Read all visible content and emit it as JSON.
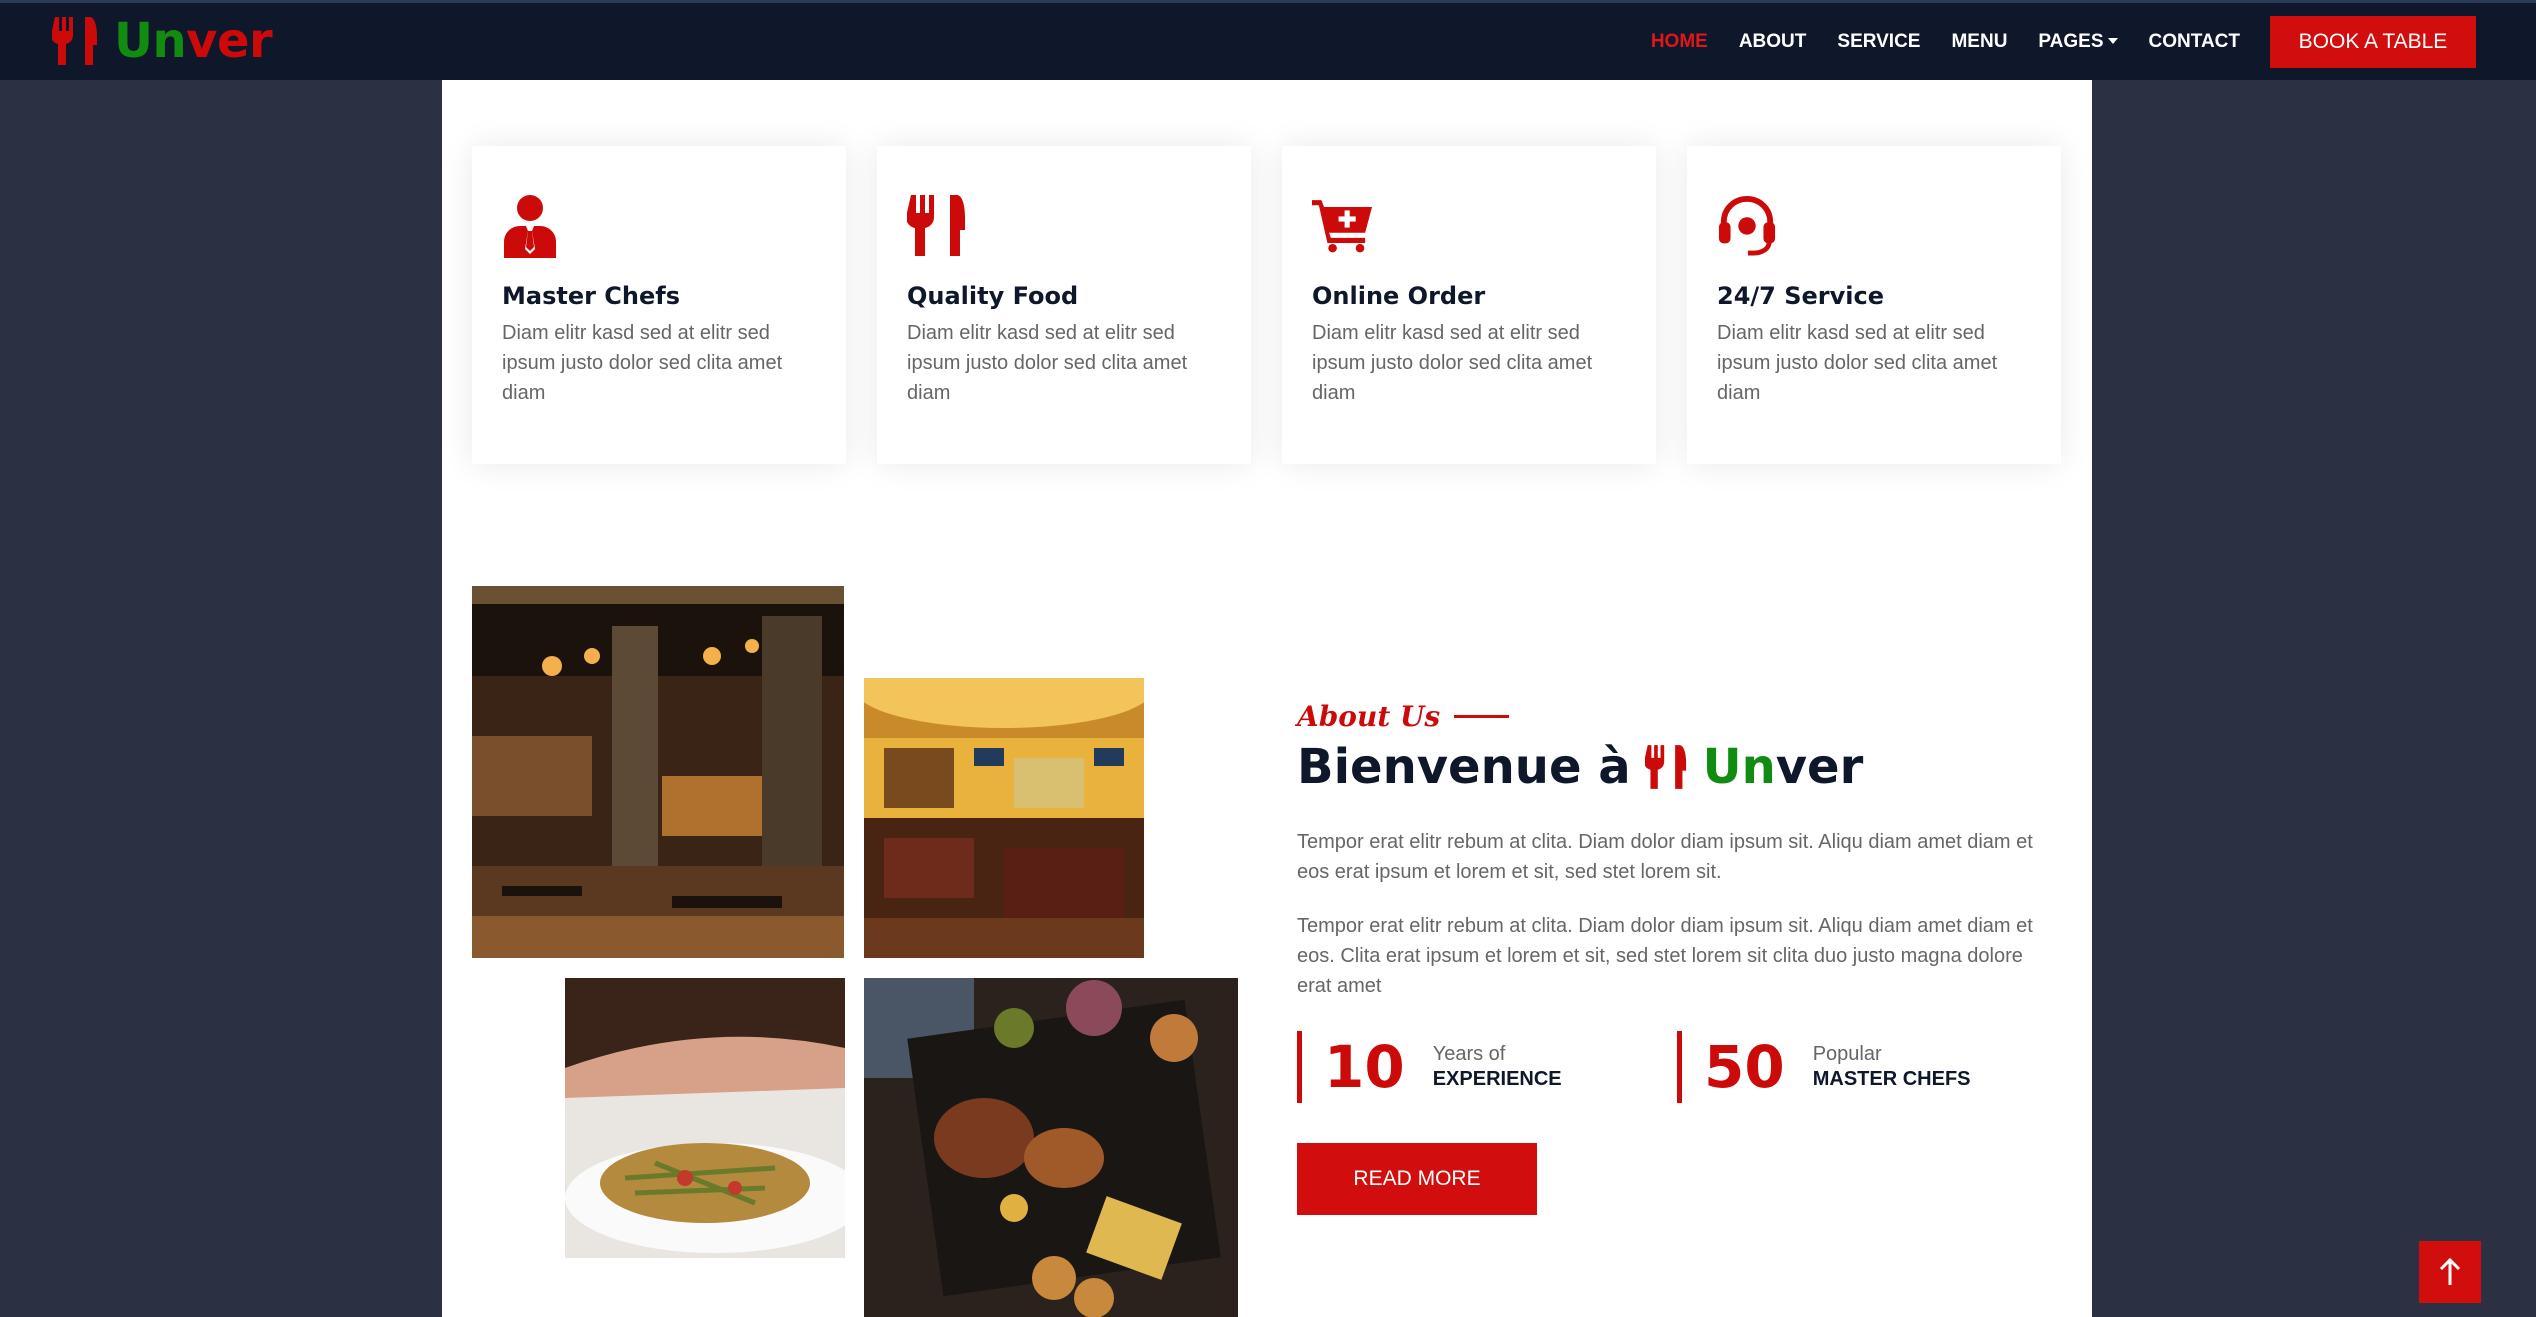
{
  "brand": {
    "name_green": "Un",
    "name_red": "ver",
    "icon": "utensils-icon"
  },
  "nav": {
    "items": [
      "HOME",
      "ABOUT",
      "SERVICE",
      "MENU",
      "PAGES",
      "CONTACT"
    ],
    "active": "HOME",
    "book_label": "BOOK A TABLE"
  },
  "features": [
    {
      "icon": "chef-icon",
      "title": "Master Chefs",
      "text": "Diam elitr kasd sed at elitr sed ipsum justo dolor sed clita amet diam"
    },
    {
      "icon": "utensils-icon",
      "title": "Quality Food",
      "text": "Diam elitr kasd sed at elitr sed ipsum justo dolor sed clita amet diam"
    },
    {
      "icon": "cart-plus-icon",
      "title": "Online Order",
      "text": "Diam elitr kasd sed at elitr sed ipsum justo dolor sed clita amet diam"
    },
    {
      "icon": "headset-icon",
      "title": "24/7 Service",
      "text": "Diam elitr kasd sed at elitr sed ipsum justo dolor sed clita amet diam"
    }
  ],
  "about": {
    "eyebrow": "About Us",
    "title_prefix": "Bienvenue à",
    "title_green": "Un",
    "title_dark": "ver",
    "p1": "Tempor erat elitr rebum at clita. Diam dolor diam ipsum sit. Aliqu diam amet diam et eos erat ipsum et lorem et sit, sed stet lorem sit.",
    "p2": "Tempor erat elitr rebum at clita. Diam dolor diam ipsum sit. Aliqu diam amet diam et eos. Clita erat ipsum et lorem et sit, sed stet lorem sit clita duo justo magna dolore erat amet",
    "stats": [
      {
        "number": "10",
        "small": "Years of",
        "big": "EXPERIENCE"
      },
      {
        "number": "50",
        "small": "Popular",
        "big": "MASTER CHEFS"
      }
    ],
    "read_more": "READ MORE"
  },
  "colors": {
    "primary": "#cc0a0a",
    "dark": "#0f172b",
    "green": "#118c11",
    "background": "#2b3042"
  },
  "back_to_top_icon": "arrow-up-icon"
}
